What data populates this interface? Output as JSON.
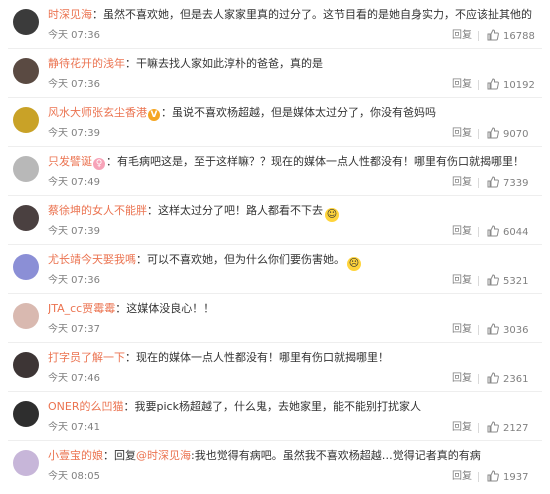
{
  "comments": [
    {
      "user": "时深见海",
      "text": "虽然不喜欢她，但是去人家家里真的过分了。这节目看的是她自身实力，不应该扯其他的",
      "time": "今天 07:36",
      "reply": "回复",
      "likes": "16788",
      "avatar_color": "#3b3b3b"
    },
    {
      "user": "静待花开的浅年",
      "text": "干嘛去找人家如此淳朴的爸爸，真的是",
      "time": "今天 07:36",
      "reply": "回复",
      "likes": "10192",
      "avatar_color": "#5a4a42"
    },
    {
      "user": "风水大师张玄尘香港",
      "text": "虽说不喜欢杨超越，但是媒体太过分了，你没有爸妈吗",
      "time": "今天 07:39",
      "reply": "回复",
      "likes": "9070",
      "avatar_color": "#c9a227",
      "badge": "V"
    },
    {
      "user": "只发譬诞",
      "text": "有毛病吧这是，至于这样嘛？？现在的媒体一点人性都没有！哪里有伤口就揭哪里！",
      "time": "今天 07:49",
      "reply": "回复",
      "likes": "7339",
      "avatar_color": "#b8b8b8",
      "badge": "♀"
    },
    {
      "user": "蔡徐坤的女人不能胖",
      "text": "这样太过分了吧！路人都看不下去",
      "time": "今天 07:39",
      "reply": "回复",
      "likes": "6044",
      "avatar_color": "#4a4040",
      "emoji": "smile"
    },
    {
      "user": "尤长靖今天娶我嗎",
      "text": "可以不喜欢她，但为什么你们要伤害她。",
      "time": "今天 07:36",
      "reply": "回复",
      "likes": "5321",
      "avatar_color": "#8b8fd6",
      "emoji": "sad"
    },
    {
      "user": "JTA_cc贾霉霉",
      "text": "这媒体没良心！！",
      "time": "今天 07:37",
      "reply": "回复",
      "likes": "3036",
      "avatar_color": "#d9b9b0"
    },
    {
      "user": "打字员了解一下",
      "text": "现在的媒体一点人性都没有！哪里有伤口就揭哪里！",
      "time": "今天 07:46",
      "reply": "回复",
      "likes": "2361",
      "avatar_color": "#3d3535"
    },
    {
      "user": "ONER的么凹猫",
      "text": "我要pick杨超越了，什么鬼，去她家里，能不能别打扰家人",
      "time": "今天 07:41",
      "reply": "回复",
      "likes": "2127",
      "avatar_color": "#2e2e2e"
    },
    {
      "user": "小壹宝的娘",
      "text_prefix": "回复",
      "reply_to": "@时深见海",
      "text": ":我也觉得有病吧。虽然我不喜欢杨超越…觉得记者真的有病",
      "time": "今天 08:05",
      "reply": "回复",
      "likes": "1937",
      "avatar_color": "#c7b6d9"
    }
  ]
}
